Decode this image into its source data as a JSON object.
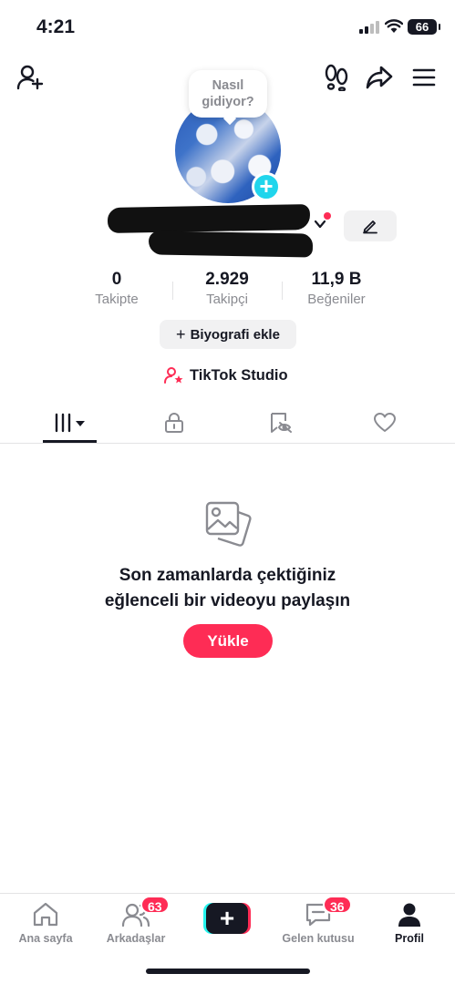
{
  "status_bar": {
    "time": "4:21",
    "battery": "66"
  },
  "profile": {
    "bubble_text_line1": "Nasıl",
    "bubble_text_line2": "gidiyor?",
    "add_badge": "+"
  },
  "stats": [
    {
      "value": "0",
      "label": "Takipte"
    },
    {
      "value": "2.929",
      "label": "Takipçi"
    },
    {
      "value": "11,9 B",
      "label": "Beğeniler"
    }
  ],
  "bio_button": {
    "plus": "+",
    "label": "Biyografi ekle"
  },
  "studio": {
    "label": "TikTok Studio"
  },
  "empty_state": {
    "title_line1": "Son zamanlarda çektiğiniz",
    "title_line2": "eğlenceli bir videoyu paylaşın",
    "upload_label": "Yükle"
  },
  "bottom_nav": {
    "home": "Ana sayfa",
    "friends": "Arkadaşlar",
    "friends_badge": "63",
    "create": "+",
    "inbox": "Gelen kutusu",
    "inbox_badge": "36",
    "profile": "Profil"
  },
  "colors": {
    "accent": "#fe2c55",
    "cyan": "#20d5ec",
    "text": "#161823",
    "muted": "#8a8b91"
  }
}
